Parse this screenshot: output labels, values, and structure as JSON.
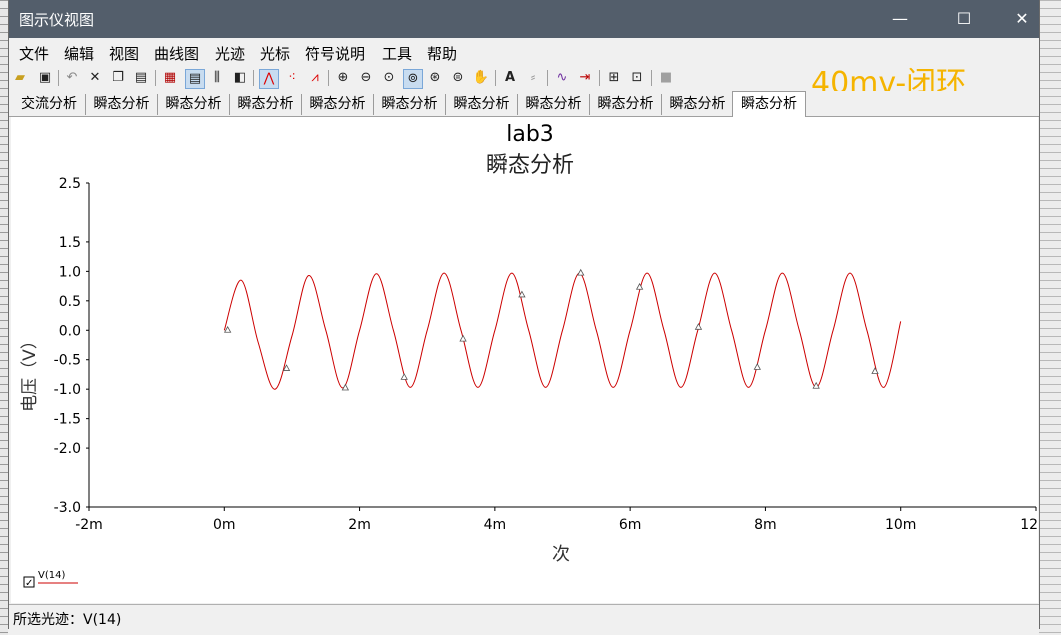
{
  "window": {
    "title": "图示仪视图",
    "minimize": "—",
    "maximize": "☐",
    "close": "✕"
  },
  "menu": [
    "文件",
    "编辑",
    "视图",
    "曲线图",
    "光迹",
    "光标",
    "符号说明",
    "工具",
    "帮助"
  ],
  "toolbar_icons": [
    "open-icon",
    "save-icon",
    "undo-icon",
    "delete-icon",
    "copy-icon",
    "paste-icon",
    "grid-icon",
    "legend-icon",
    "bar-icon",
    "window-icon",
    "trace-line-icon",
    "trace-points-icon",
    "trace-both-icon",
    "zoom-in-icon",
    "zoom-out-icon",
    "zoom-fit-icon",
    "zoom-x-icon",
    "zoom-y-icon",
    "zoom-area-icon",
    "pan-icon",
    "text-icon",
    "label-icon",
    "compare-icon",
    "export-icon",
    "excel-icon",
    "copy-data-icon",
    "stop-icon"
  ],
  "overlay_label": "40mv-闭环",
  "tabs": [
    "交流分析",
    "瞬态分析",
    "瞬态分析",
    "瞬态分析",
    "瞬态分析",
    "瞬态分析",
    "瞬态分析",
    "瞬态分析",
    "瞬态分析",
    "瞬态分析",
    "瞬态分析"
  ],
  "active_tab_index": 10,
  "status": "所选光迹：V(14)",
  "chart_data": {
    "type": "line",
    "title": "lab3",
    "subtitle": "瞬态分析",
    "xlabel": "次",
    "ylabel": "电压（V）",
    "x_unit": "ms",
    "xlim": [
      -2,
      12
    ],
    "ylim": [
      -3.0,
      2.5
    ],
    "x_ticks": [
      "-2m",
      "0m",
      "2m",
      "4m",
      "6m",
      "8m",
      "10m",
      "12m"
    ],
    "y_ticks": [
      "2.5",
      "1.5",
      "1.0",
      "0.5",
      "0.0",
      "-0.5",
      "-1.0",
      "-1.5",
      "-2.0",
      "-3.0"
    ],
    "grid": false,
    "legend": "bottom-left",
    "series": [
      {
        "name": "V(14)",
        "color": "#cc0000",
        "x": [
          0,
          0.25,
          0.5,
          0.75,
          1.0,
          1.25,
          1.5,
          1.75,
          2.0,
          2.25,
          2.5,
          2.75,
          3.0,
          3.25,
          3.5,
          3.75,
          4.0,
          4.25,
          4.5,
          4.75,
          5.0,
          5.25,
          5.5,
          5.75,
          6.0,
          6.25,
          6.5,
          6.75,
          7.0,
          7.25,
          7.5,
          7.75,
          8.0,
          8.25,
          8.5,
          8.75,
          9.0,
          9.25,
          9.5,
          9.75,
          10.0
        ],
        "y": [
          0.0,
          0.85,
          -0.2,
          -1.0,
          -0.1,
          0.93,
          0.0,
          -0.98,
          0.0,
          0.96,
          0.0,
          -0.97,
          0.0,
          0.97,
          0.0,
          -0.97,
          0.0,
          0.97,
          0.0,
          -0.97,
          0.0,
          0.97,
          0.0,
          -0.97,
          0.0,
          0.97,
          0.0,
          -0.97,
          0.0,
          0.97,
          0.0,
          -0.97,
          0.0,
          0.97,
          0.0,
          -0.97,
          0.0,
          0.97,
          0.0,
          -0.97,
          0.15
        ],
        "marker_x": [
          0.05,
          0.92,
          1.79,
          2.66,
          3.53,
          4.4,
          5.27,
          6.14,
          7.01,
          7.88,
          8.75,
          9.62
        ],
        "marker_y": [
          0.0,
          -0.65,
          -0.98,
          -0.8,
          -0.15,
          0.6,
          0.97,
          0.73,
          0.05,
          -0.63,
          -0.95,
          -0.7
        ]
      }
    ]
  }
}
